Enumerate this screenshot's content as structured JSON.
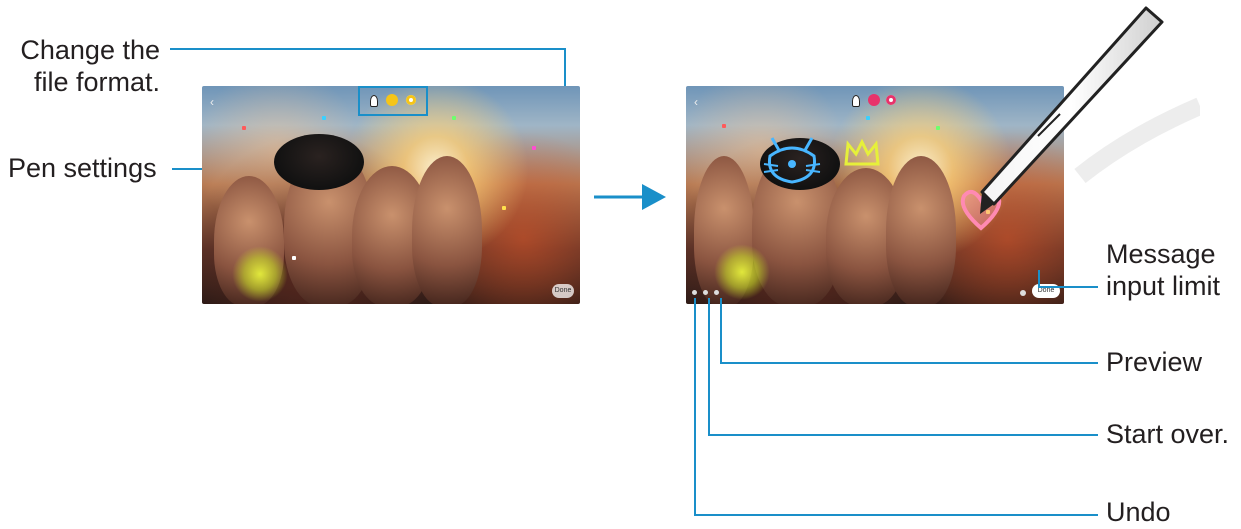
{
  "callouts": {
    "change_format": [
      "Change the",
      "file format."
    ],
    "pen_settings": "Pen settings",
    "message_limit": [
      "Message",
      "input limit"
    ],
    "preview": "Preview",
    "start_over": "Start over.",
    "undo": "Undo"
  },
  "screens": {
    "left": {
      "done_label": "Done",
      "colors": [
        "#f5c518",
        "#f5c518"
      ]
    },
    "right": {
      "done_label": "Done",
      "colors": [
        "#e8336b",
        "#e8336b"
      ]
    }
  },
  "colors": {
    "accent": "#1a8fc9",
    "text": "#231f20"
  },
  "icons": [
    "back-chevron-icon",
    "pen-icon",
    "color-dot-icon",
    "arrow-right-icon",
    "s-pen-icon",
    "heart-doodle-icon",
    "crown-doodle-icon",
    "cat-face-doodle-icon"
  ]
}
